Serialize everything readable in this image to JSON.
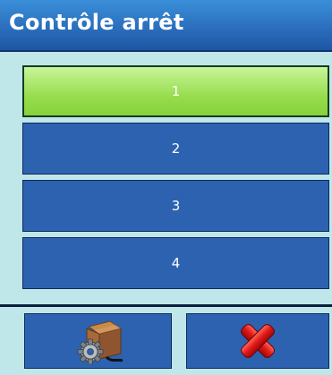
{
  "title_bar": {
    "title": "Contrôle arrêt"
  },
  "list": {
    "items": [
      {
        "label": "1",
        "selected": true
      },
      {
        "label": "2",
        "selected": false
      },
      {
        "label": "3",
        "selected": false
      },
      {
        "label": "4",
        "selected": false
      }
    ]
  },
  "soft_keys": [
    {
      "icon": "box-gear-icon"
    },
    {
      "icon": "red-x-cancel-icon"
    }
  ],
  "colors": {
    "title_bar": "#2b6fbd",
    "background": "#bfe6e8",
    "item": "#2d62b1",
    "item_selected": "#98dd4e",
    "cancel": "#e01818"
  }
}
